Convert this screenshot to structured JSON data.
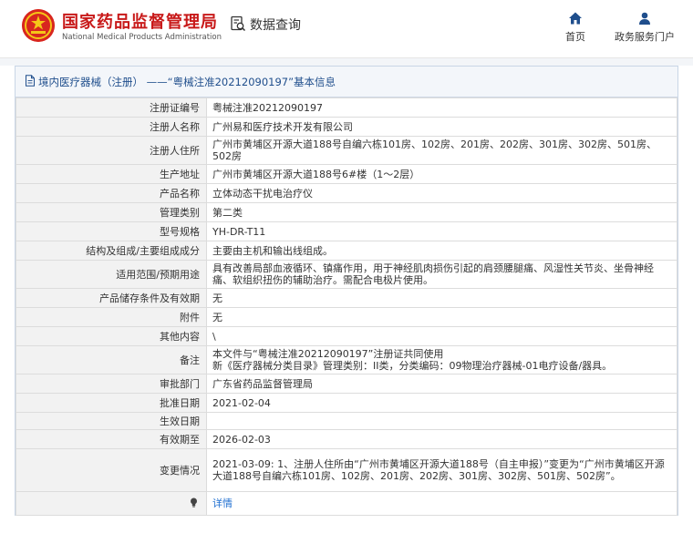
{
  "header": {
    "org_name_cn": "国家药品监督管理局",
    "org_name_en": "National Medical Products Administration",
    "search_label": "数据查询",
    "nav": {
      "home": "首页",
      "gov_portal": "政务服务门户"
    }
  },
  "panel": {
    "title": "境内医疗器械（注册） ——“粤械注准20212090197”基本信息"
  },
  "rows": [
    {
      "label": "注册证编号",
      "value": "粤械注准20212090197"
    },
    {
      "label": "注册人名称",
      "value": "广州易和医疗技术开发有限公司"
    },
    {
      "label": "注册人住所",
      "value": "广州市黄埔区开源大道188号自编六栋101房、102房、201房、202房、301房、302房、501房、502房"
    },
    {
      "label": "生产地址",
      "value": "广州市黄埔区开源大道188号6#楼（1～2层）"
    },
    {
      "label": "产品名称",
      "value": "立体动态干扰电治疗仪"
    },
    {
      "label": "管理类别",
      "value": "第二类"
    },
    {
      "label": "型号规格",
      "value": "YH-DR-T11"
    },
    {
      "label": "结构及组成/主要组成成分",
      "value": "主要由主机和输出线组成。"
    },
    {
      "label": "适用范围/预期用途",
      "value": "具有改善局部血液循环、镇痛作用，用于神经肌肉损伤引起的肩颈腰腿痛、风湿性关节炎、坐骨神经痛、软组织扭伤的辅助治疗。需配合电极片使用。"
    },
    {
      "label": "产品储存条件及有效期",
      "value": "无"
    },
    {
      "label": "附件",
      "value": "无"
    },
    {
      "label": "其他内容",
      "value": "\\"
    },
    {
      "label": "备注",
      "value": "本文件与“粤械注准20212090197”注册证共同使用",
      "value2": "新《医疗器械分类目录》管理类别：II类，分类编码：09物理治疗器械-01电疗设备/器具。"
    },
    {
      "label": "审批部门",
      "value": "广东省药品监督管理局"
    },
    {
      "label": "批准日期",
      "value": "2021-02-04"
    },
    {
      "label": "生效日期",
      "value": ""
    },
    {
      "label": "有效期至",
      "value": "2026-02-03"
    },
    {
      "label": "变更情况",
      "value": "2021-03-09: 1、注册人住所由“广州市黄埔区开源大道188号（自主申报）”变更为“广州市黄埔区开源大道188号自编六栋101房、102房、201房、202房、301房、302房、501房、502房”。"
    },
    {
      "label": "",
      "value": "详情"
    }
  ],
  "colors": {
    "brand_red": "#c81919",
    "panel_title_blue": "#1f4e8c",
    "link_blue": "#1f6fd1",
    "nav_icon_blue": "#1f4e8c",
    "label_bg": "#f2f2f2"
  },
  "icons": [
    "emblem-logo",
    "search-doc-icon",
    "home-icon",
    "user-icon",
    "document-icon",
    "lightbulb-icon"
  ]
}
